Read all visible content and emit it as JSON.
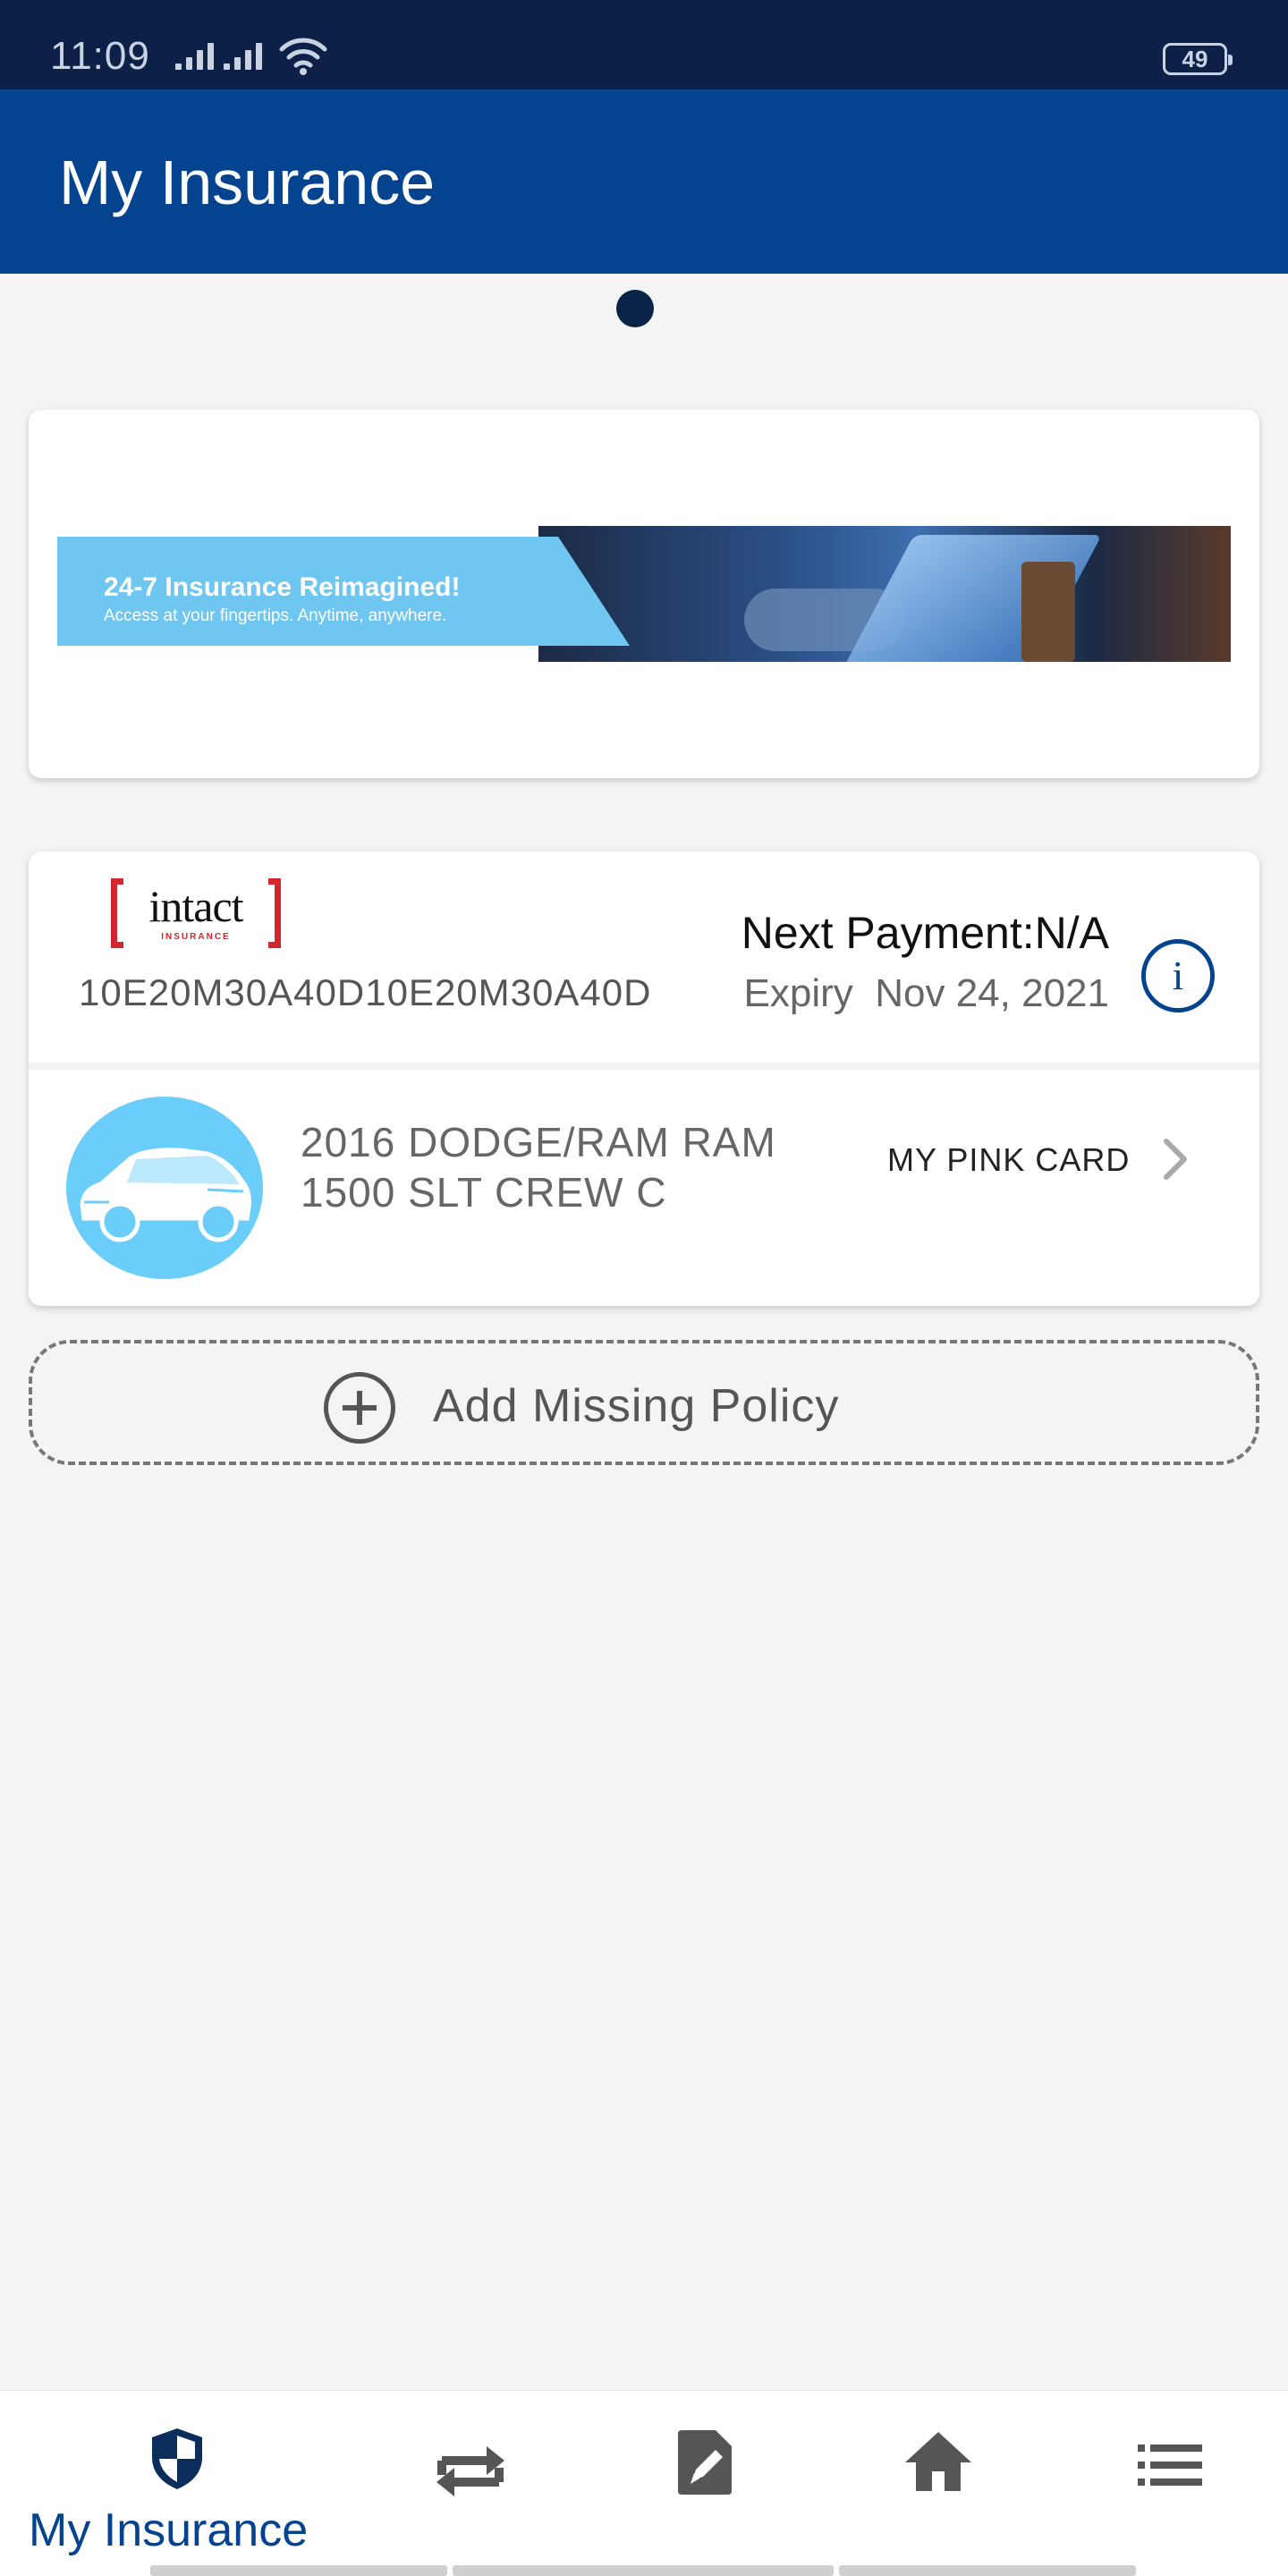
{
  "status_bar": {
    "time": "11:09",
    "battery": "49",
    "icons": [
      "signal-icon",
      "signal-icon",
      "wifi-icon",
      "battery-icon"
    ]
  },
  "app_bar": {
    "title": "My Insurance"
  },
  "banner": {
    "headline": "24-7 Insurance Reimagined!",
    "subline": "Access at your fingertips. Anytime, anywhere."
  },
  "policy": {
    "insurer_logo_text": "intact",
    "insurer_logo_subtext": "INSURANCE",
    "policy_number": "10E20M30A40D10E20M30A40D",
    "next_payment": "Next Payment:N/A",
    "expiry": "Expiry  Nov 24, 2021",
    "info_icon_glyph": "i",
    "vehicle": {
      "line1": "2016 DODGE/RAM RAM",
      "line2": "1500 SLT CREW C",
      "pink_card_label": "MY PINK CARD"
    }
  },
  "add_policy": {
    "label": "Add Missing Policy"
  },
  "bottom_nav": {
    "items": [
      {
        "icon": "shield-icon",
        "label": "My Insurance",
        "active": true
      },
      {
        "icon": "transfer-icon",
        "label": ""
      },
      {
        "icon": "edit-document-icon",
        "label": ""
      },
      {
        "icon": "home-icon",
        "label": ""
      },
      {
        "icon": "list-menu-icon",
        "label": ""
      }
    ]
  },
  "colors": {
    "status_bar": "#0d2148",
    "app_bar": "#03438f",
    "accent": "#03438f",
    "car_avatar": "#6bcdf9",
    "banner_blue": "#6fc6f1",
    "intact_red": "#d3262e"
  }
}
